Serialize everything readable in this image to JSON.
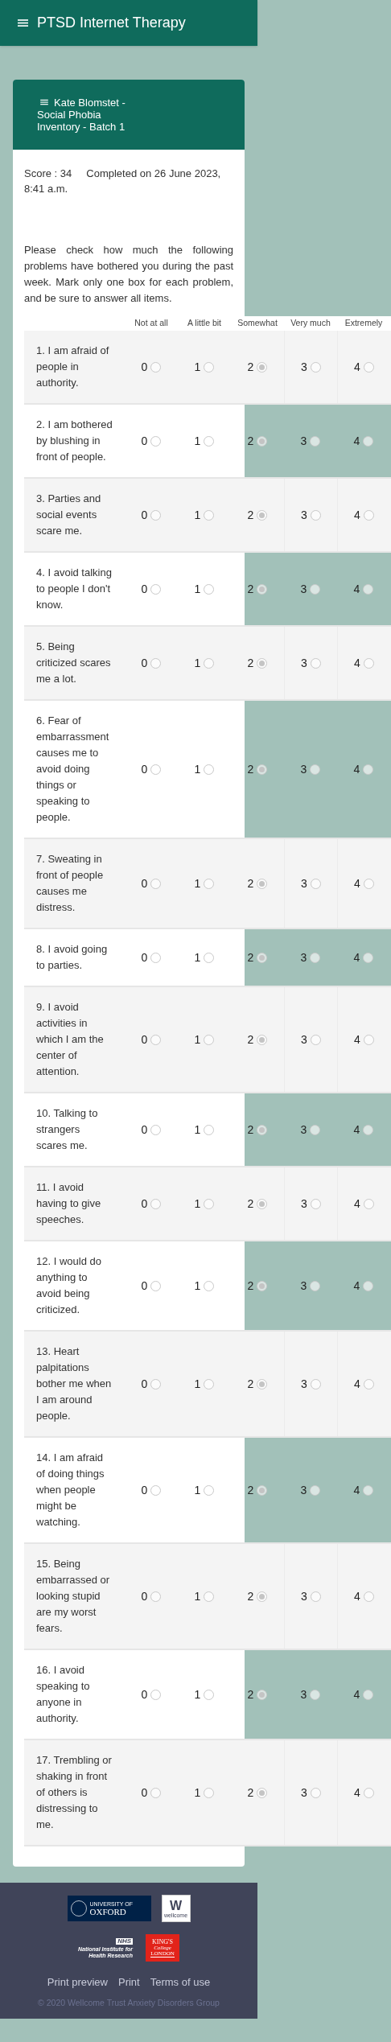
{
  "app_bar": {
    "title": "PTSD Internet Therapy"
  },
  "card": {
    "title": "Kate Blomstet - Social Phobia Inventory - Batch 1",
    "score": "Score : 34",
    "completed": "Completed on 26 June 2023, 8:41 a.m.",
    "instructions": "Please check how much the following problems have bothered you during the past week. Mark only one box for each problem, and be sure to answer all items."
  },
  "table": {
    "columns": [
      "Not at all",
      "A little bit",
      "Somewhat",
      "Very much",
      "Extremely"
    ],
    "rows": [
      {
        "question": "1. I am afraid of people in authority.",
        "options": [
          {
            "label": "0",
            "selected": false
          },
          {
            "label": "1",
            "selected": false
          },
          {
            "label": "2",
            "selected": true
          },
          {
            "label": "3",
            "selected": false
          },
          {
            "label": "4",
            "selected": false
          }
        ]
      },
      {
        "question": "2. I am bothered by blushing in front of people.",
        "options": [
          {
            "label": "0",
            "selected": false
          },
          {
            "label": "1",
            "selected": false
          },
          {
            "label": "2",
            "selected": true
          },
          {
            "label": "3",
            "selected": false
          },
          {
            "label": "4",
            "selected": false
          }
        ]
      },
      {
        "question": "3. Parties and social events scare me.",
        "options": [
          {
            "label": "0",
            "selected": false
          },
          {
            "label": "1",
            "selected": false
          },
          {
            "label": "2",
            "selected": true
          },
          {
            "label": "3",
            "selected": false
          },
          {
            "label": "4",
            "selected": false
          }
        ]
      },
      {
        "question": "4. I avoid talking to people I don't know.",
        "options": [
          {
            "label": "0",
            "selected": false
          },
          {
            "label": "1",
            "selected": false
          },
          {
            "label": "2",
            "selected": true
          },
          {
            "label": "3",
            "selected": false
          },
          {
            "label": "4",
            "selected": false
          }
        ]
      },
      {
        "question": "5. Being criticized scares me a lot.",
        "options": [
          {
            "label": "0",
            "selected": false
          },
          {
            "label": "1",
            "selected": false
          },
          {
            "label": "2",
            "selected": true
          },
          {
            "label": "3",
            "selected": false
          },
          {
            "label": "4",
            "selected": false
          }
        ]
      },
      {
        "question": "6. Fear of embarrassment causes me to avoid doing things or speaking to people.",
        "options": [
          {
            "label": "0",
            "selected": false
          },
          {
            "label": "1",
            "selected": false
          },
          {
            "label": "2",
            "selected": true
          },
          {
            "label": "3",
            "selected": false
          },
          {
            "label": "4",
            "selected": false
          }
        ]
      },
      {
        "question": "7. Sweating in front of people causes me distress.",
        "options": [
          {
            "label": "0",
            "selected": false
          },
          {
            "label": "1",
            "selected": false
          },
          {
            "label": "2",
            "selected": true
          },
          {
            "label": "3",
            "selected": false
          },
          {
            "label": "4",
            "selected": false
          }
        ]
      },
      {
        "question": "8. I avoid going to parties.",
        "options": [
          {
            "label": "0",
            "selected": false
          },
          {
            "label": "1",
            "selected": false
          },
          {
            "label": "2",
            "selected": true
          },
          {
            "label": "3",
            "selected": false
          },
          {
            "label": "4",
            "selected": false
          }
        ]
      },
      {
        "question": "9. I avoid activities in which I am the center of attention.",
        "options": [
          {
            "label": "0",
            "selected": false
          },
          {
            "label": "1",
            "selected": false
          },
          {
            "label": "2",
            "selected": true
          },
          {
            "label": "3",
            "selected": false
          },
          {
            "label": "4",
            "selected": false
          }
        ]
      },
      {
        "question": "10. Talking to strangers scares me.",
        "options": [
          {
            "label": "0",
            "selected": false
          },
          {
            "label": "1",
            "selected": false
          },
          {
            "label": "2",
            "selected": true
          },
          {
            "label": "3",
            "selected": false
          },
          {
            "label": "4",
            "selected": false
          }
        ]
      },
      {
        "question": "11. I avoid having to give speeches.",
        "options": [
          {
            "label": "0",
            "selected": false
          },
          {
            "label": "1",
            "selected": false
          },
          {
            "label": "2",
            "selected": true
          },
          {
            "label": "3",
            "selected": false
          },
          {
            "label": "4",
            "selected": false
          }
        ]
      },
      {
        "question": "12. I would do anything to avoid being criticized.",
        "options": [
          {
            "label": "0",
            "selected": false
          },
          {
            "label": "1",
            "selected": false
          },
          {
            "label": "2",
            "selected": true
          },
          {
            "label": "3",
            "selected": false
          },
          {
            "label": "4",
            "selected": false
          }
        ]
      },
      {
        "question": "13. Heart palpitations bother me when I am around people.",
        "options": [
          {
            "label": "0",
            "selected": false
          },
          {
            "label": "1",
            "selected": false
          },
          {
            "label": "2",
            "selected": true
          },
          {
            "label": "3",
            "selected": false
          },
          {
            "label": "4",
            "selected": false
          }
        ]
      },
      {
        "question": "14. I am afraid of doing things when people might be watching.",
        "options": [
          {
            "label": "0",
            "selected": false
          },
          {
            "label": "1",
            "selected": false
          },
          {
            "label": "2",
            "selected": true
          },
          {
            "label": "3",
            "selected": false
          },
          {
            "label": "4",
            "selected": false
          }
        ]
      },
      {
        "question": "15. Being embarrassed or looking stupid are my worst fears.",
        "options": [
          {
            "label": "0",
            "selected": false
          },
          {
            "label": "1",
            "selected": false
          },
          {
            "label": "2",
            "selected": true
          },
          {
            "label": "3",
            "selected": false
          },
          {
            "label": "4",
            "selected": false
          }
        ]
      },
      {
        "question": "16. I avoid speaking to anyone in authority.",
        "options": [
          {
            "label": "0",
            "selected": false
          },
          {
            "label": "1",
            "selected": false
          },
          {
            "label": "2",
            "selected": true
          },
          {
            "label": "3",
            "selected": false
          },
          {
            "label": "4",
            "selected": false
          }
        ]
      },
      {
        "question": "17. Trembling or shaking in front of others is distressing to me.",
        "options": [
          {
            "label": "0",
            "selected": false
          },
          {
            "label": "1",
            "selected": false
          },
          {
            "label": "2",
            "selected": true
          },
          {
            "label": "3",
            "selected": false
          },
          {
            "label": "4",
            "selected": false
          }
        ]
      }
    ]
  },
  "footer": {
    "logos": [
      {
        "kind": "oxford",
        "lines": [
          "UNIVERSITY OF",
          "OXFORD"
        ]
      },
      {
        "kind": "wellcome",
        "lines": [
          "W",
          "wellcome"
        ]
      },
      {
        "kind": "nihr",
        "lines": [
          "NHS",
          "National Institute for",
          "Health Research"
        ]
      },
      {
        "kind": "kings",
        "lines": [
          "KING'S",
          "College",
          "LONDON"
        ]
      }
    ],
    "links": [
      "Print preview",
      "Print",
      "Terms of use"
    ],
    "copyright": "© 2020 Wellcome Trust Anxiety Disorders Group"
  }
}
